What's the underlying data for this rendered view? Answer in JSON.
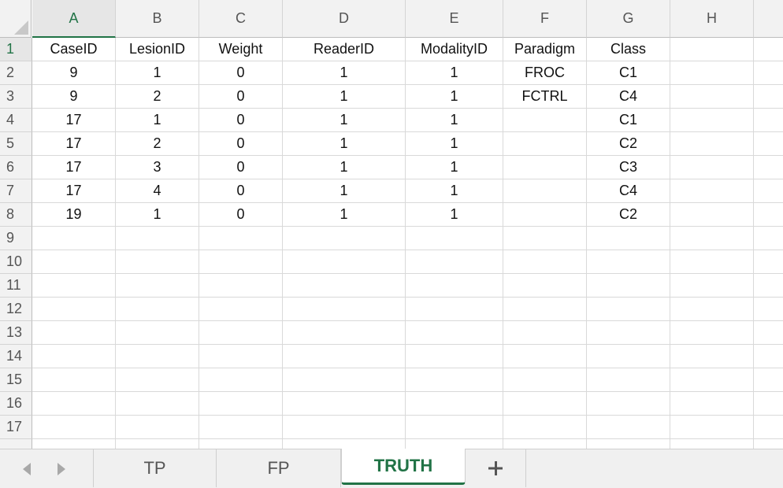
{
  "sheet": {
    "columns": [
      "A",
      "B",
      "C",
      "D",
      "E",
      "F",
      "G",
      "H"
    ],
    "selected_column": "A",
    "selected_row": "1",
    "row_numbers": [
      "1",
      "2",
      "3",
      "4",
      "5",
      "6",
      "7",
      "8",
      "9",
      "10",
      "11",
      "12",
      "13",
      "14",
      "15",
      "16",
      "17"
    ],
    "rows": [
      [
        "CaseID",
        "LesionID",
        "Weight",
        "ReaderID",
        "ModalityID",
        "Paradigm",
        "Class",
        ""
      ],
      [
        "9",
        "1",
        "0",
        "1",
        "1",
        "FROC",
        "C1",
        ""
      ],
      [
        "9",
        "2",
        "0",
        "1",
        "1",
        "FCTRL",
        "C4",
        ""
      ],
      [
        "17",
        "1",
        "0",
        "1",
        "1",
        "",
        "C1",
        ""
      ],
      [
        "17",
        "2",
        "0",
        "1",
        "1",
        "",
        "C2",
        ""
      ],
      [
        "17",
        "3",
        "0",
        "1",
        "1",
        "",
        "C3",
        ""
      ],
      [
        "17",
        "4",
        "0",
        "1",
        "1",
        "",
        "C4",
        ""
      ],
      [
        "19",
        "1",
        "0",
        "1",
        "1",
        "",
        "C2",
        ""
      ]
    ]
  },
  "tabs": [
    {
      "label": "TP",
      "active": false
    },
    {
      "label": "FP",
      "active": false
    },
    {
      "label": "TRUTH",
      "active": true
    }
  ],
  "icons": {
    "prev": "chevron-left-icon",
    "next": "chevron-right-icon",
    "add": "plus-icon"
  },
  "colors": {
    "accent": "#217346",
    "gridline": "#d9d9d9",
    "header_bg": "#f2f2f2"
  }
}
